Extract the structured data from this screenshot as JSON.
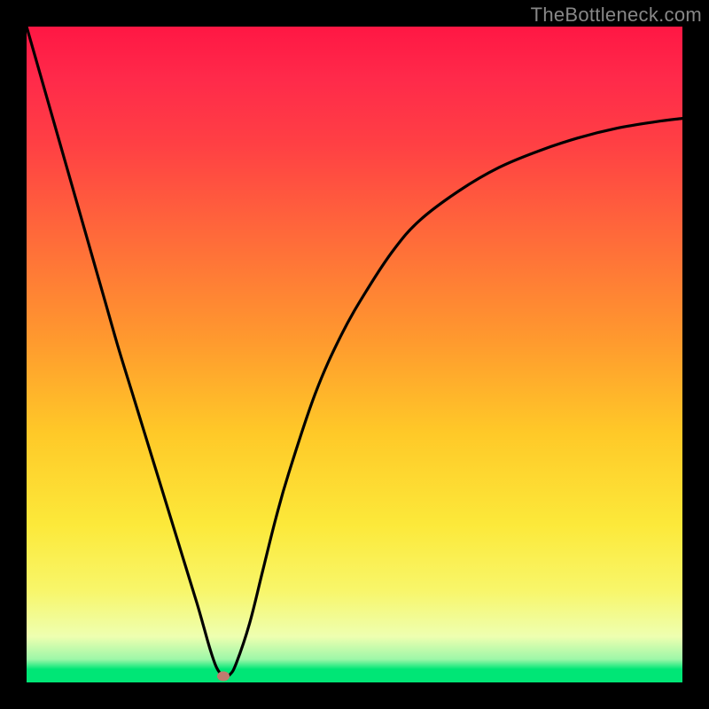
{
  "watermark": "TheBottleneck.com",
  "colors": {
    "page_bg": "#000000",
    "curve": "#000000",
    "marker": "#bf7b6f",
    "gradient_top": "#ff1744",
    "gradient_mid": "#ffc928",
    "gradient_bottom": "#00e676"
  },
  "chart_data": {
    "type": "line",
    "title": "",
    "xlabel": "",
    "ylabel": "",
    "xlim": [
      0,
      100
    ],
    "ylim": [
      0,
      100
    ],
    "grid": false,
    "legend": false,
    "series": [
      {
        "name": "bottleneck-curve",
        "x": [
          0,
          2,
          4,
          6,
          8,
          10,
          12,
          14,
          16,
          18,
          20,
          22,
          24,
          26,
          27,
          28,
          29,
          30,
          31,
          32,
          34,
          36,
          38,
          40,
          44,
          48,
          52,
          56,
          60,
          66,
          72,
          78,
          84,
          90,
          96,
          100
        ],
        "y": [
          100,
          93,
          86,
          79,
          72,
          65,
          58,
          51,
          44.5,
          38,
          31.5,
          25,
          18.5,
          12,
          8.5,
          5,
          2.2,
          1.0,
          1.2,
          3.0,
          9,
          17,
          25,
          32,
          44,
          53,
          60,
          66,
          70.5,
          75,
          78.5,
          81,
          83,
          84.5,
          85.5,
          86
        ]
      }
    ],
    "marker": {
      "x": 30,
      "y": 1.0
    },
    "background_gradient": {
      "direction": "vertical",
      "stops": [
        {
          "pct": 0,
          "color": "#ff1744"
        },
        {
          "pct": 48,
          "color": "#ff9a2e"
        },
        {
          "pct": 76,
          "color": "#fce93a"
        },
        {
          "pct": 97,
          "color": "#9cf7a8"
        },
        {
          "pct": 100,
          "color": "#00e676"
        }
      ]
    }
  }
}
